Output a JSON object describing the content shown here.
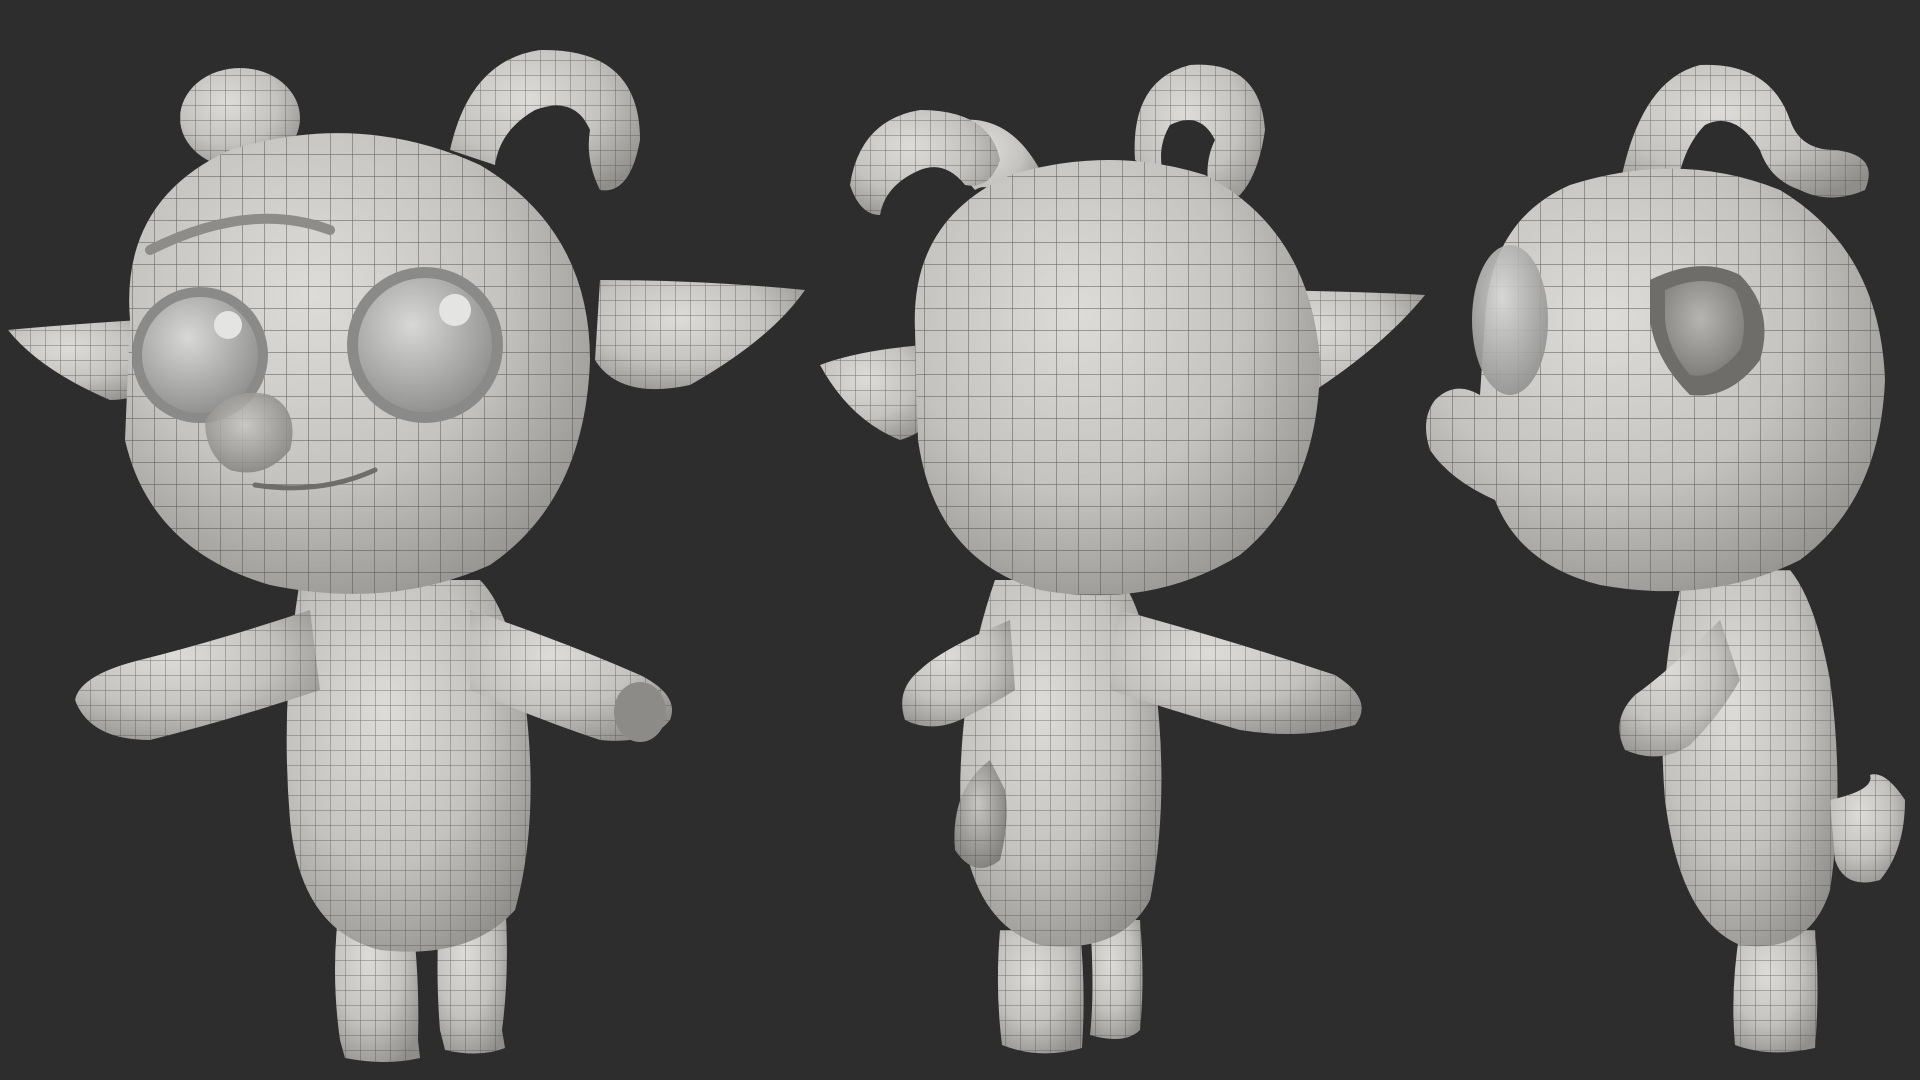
{
  "scene": {
    "background_color": "#2c2c2c",
    "model_color": "#c9c8c4",
    "wire_color": "#4a4a48",
    "views": [
      {
        "name": "front-three-quarter",
        "description_icon": "goat-front-icon"
      },
      {
        "name": "back",
        "description_icon": "goat-back-icon"
      },
      {
        "name": "side",
        "description_icon": "goat-side-icon"
      }
    ]
  }
}
